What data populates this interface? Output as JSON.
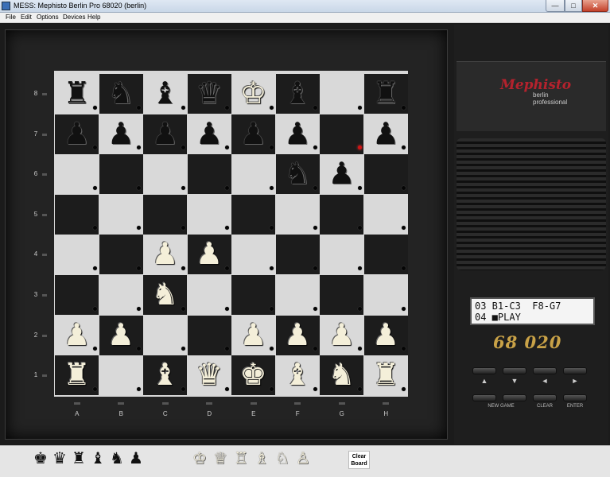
{
  "window": {
    "title": "MESS: Mephisto Berlin Pro 68020 (berlin)",
    "min": "—",
    "max": "□",
    "close": "✕"
  },
  "menu": [
    "File",
    "Edit",
    "Options",
    "Devices",
    "Help"
  ],
  "files": [
    "A",
    "B",
    "C",
    "D",
    "E",
    "F",
    "G",
    "H"
  ],
  "ranks": [
    "8",
    "7",
    "6",
    "5",
    "4",
    "3",
    "2",
    "1"
  ],
  "board": [
    [
      "r",
      "n",
      "b",
      "q",
      "K",
      "b",
      "",
      "r"
    ],
    [
      "p",
      "p",
      "p",
      "p",
      "p",
      "p",
      "",
      "p"
    ],
    [
      "",
      "",
      "",
      "",
      "",
      "n",
      "p",
      ""
    ],
    [
      "",
      "",
      "",
      "",
      "",
      "",
      "",
      ""
    ],
    [
      "",
      "",
      "P",
      "P",
      "",
      "",
      "",
      ""
    ],
    [
      "",
      "",
      "N",
      "",
      "",
      "",
      "",
      ""
    ],
    [
      "P",
      "P",
      "",
      "",
      "P",
      "P",
      "P",
      "P"
    ],
    [
      "R",
      "",
      "B",
      "Q",
      "K",
      "B",
      "N",
      "R"
    ]
  ],
  "lit_led": "G7",
  "brand": {
    "logo": "Mephisto",
    "line1": "berlin",
    "line2": "professional",
    "model": "68 020"
  },
  "lcd": {
    "line1": "03 B1-C3  F8-G7",
    "line2": "04 ■PLAY"
  },
  "keys": {
    "arrows": [
      "▲",
      "▼",
      "◄",
      "►"
    ],
    "labels": [
      "NEW GAME",
      "CLEAR",
      "ENTER"
    ]
  },
  "tray": {
    "black": [
      "♚",
      "♛",
      "♜",
      "♝",
      "♞",
      "♟"
    ],
    "white": [
      "♔",
      "♕",
      "♖",
      "♗",
      "♘",
      "♙"
    ],
    "clear_label": "Clear\nBoard"
  }
}
